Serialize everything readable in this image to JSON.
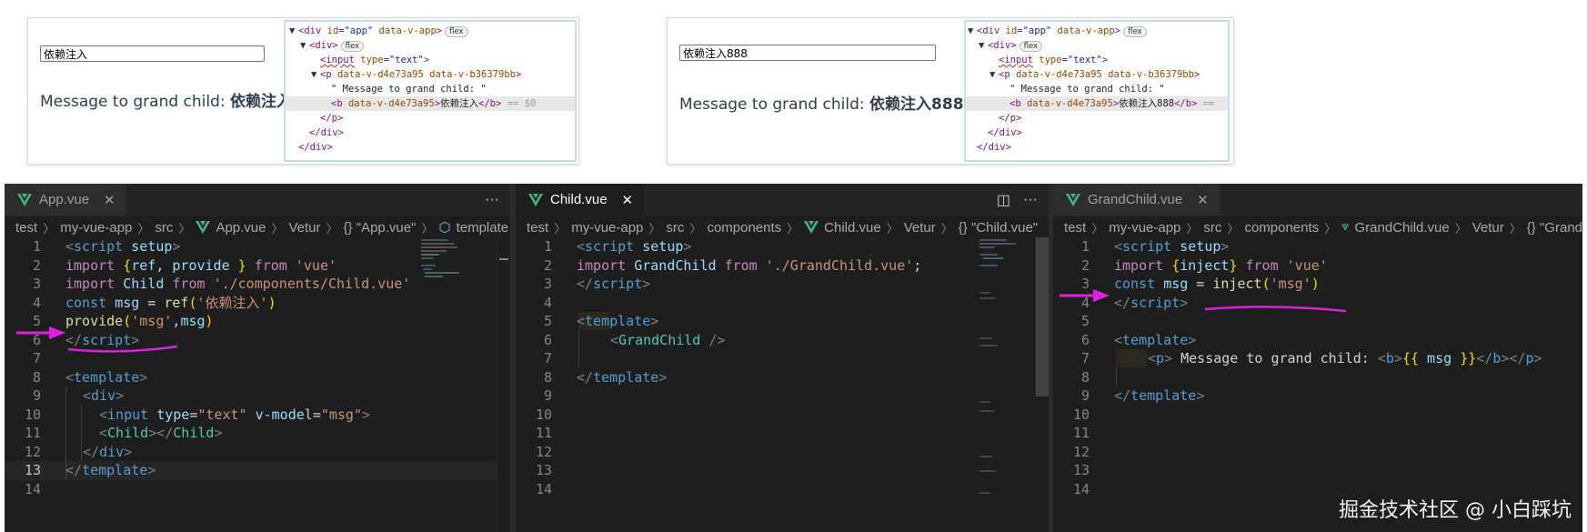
{
  "previews": [
    {
      "input_value": "依赖注入",
      "message_prefix": "Message to grand child:",
      "message_value": "依赖注入",
      "devtools": {
        "l1_tag": "<div",
        "l1_attr1": "id",
        "l1_val1": "\"app\"",
        "l1_attr2": "data-v-app",
        "l1_close": ">",
        "l1_badge": "flex",
        "l2_tag": "<div>",
        "l2_badge": "flex",
        "l3_tag": "<input",
        "l3_attr": "type",
        "l3_val": "\"text\"",
        "l3_close": ">",
        "l4_tag": "<p",
        "l4_attrs": "data-v-d4e73a95 data-v-b36379bb",
        "l4_close": ">",
        "l5_text": "\" Message to grand child: \"",
        "l6_tag": "<b",
        "l6_attr": "data-v-d4e73a95",
        "l6_text": "依赖注入",
        "l6_close": "</b>",
        "l6_tail": "== $0",
        "l7": "</p>",
        "l8": "</div>",
        "l9": "</div>"
      }
    },
    {
      "input_value": "依赖注入888",
      "message_prefix": "Message to grand child:",
      "message_value": "依赖注入888",
      "devtools": {
        "l1_tag": "<div",
        "l1_attr1": "id",
        "l1_val1": "\"app\"",
        "l1_attr2": "data-v-app",
        "l1_close": ">",
        "l1_badge": "flex",
        "l2_tag": "<div>",
        "l2_badge": "flex",
        "l3_tag": "<input",
        "l3_attr": "type",
        "l3_val": "\"text\"",
        "l3_close": ">",
        "l4_tag": "<p",
        "l4_attrs": "data-v-d4e73a95 data-v-b36379bb",
        "l4_close": ">",
        "l5_text": "\" Message to grand child: \"",
        "l6_tag": "<b",
        "l6_attr": "data-v-d4e73a95",
        "l6_text": "依赖注入888",
        "l6_close": "</b>",
        "l6_tail": "==",
        "l7": "</p>",
        "l8": "</div>",
        "l9": "</div>"
      }
    }
  ],
  "editors": [
    {
      "tab": "App.vue",
      "tab_active": false,
      "close": "✕",
      "actions": [
        "···"
      ],
      "breadcrumb": [
        "test",
        "my-vue-app",
        "src",
        "App.vue",
        "Vetur",
        "{} \"App.vue\"",
        "template"
      ],
      "line_numbers": [
        "1",
        "2",
        "3",
        "4",
        "5",
        "6",
        "7",
        "8",
        "9",
        "10",
        "11",
        "12",
        "13",
        "14"
      ],
      "current_line": "13",
      "code": {
        "l1a": "<",
        "l1b": "script",
        "l1c": "setup",
        "l1d": ">",
        "l2a": "import",
        "l2b": "{",
        "l2c": "ref",
        "l2d": ", ",
        "l2e": "provide",
        "l2f": " }",
        "l2g": "from",
        "l2h": "'vue'",
        "l3a": "import",
        "l3b": "Child",
        "l3c": "from",
        "l3d": "'./components/Child.vue'",
        "l4a": "const",
        "l4b": "msg",
        "l4c": " = ",
        "l4d": "ref",
        "l4e": "(",
        "l4f": "'依赖注入'",
        "l4g": ")",
        "l5a": "provide",
        "l5b": "(",
        "l5c": "'msg'",
        "l5d": ",",
        "l5e": "msg",
        "l5f": ")",
        "l6a": "</",
        "l6b": "script",
        "l6c": ">",
        "l8a": "<",
        "l8b": "template",
        "l8c": ">",
        "l9a": "<",
        "l9b": "div",
        "l9c": ">",
        "l10a": "<",
        "l10b": "input",
        "l10c": "type",
        "l10d": "=",
        "l10e": "\"text\"",
        "l10f": "v-model",
        "l10g": "=",
        "l10h": "\"msg\"",
        "l10i": ">",
        "l11a": "<",
        "l11b": "Child",
        "l11c": "></",
        "l11d": "Child",
        "l11e": ">",
        "l12a": "</",
        "l12b": "div",
        "l12c": ">",
        "l13a": "</",
        "l13b": "template",
        "l13c": ">"
      }
    },
    {
      "tab": "Child.vue",
      "tab_active": true,
      "close": "✕",
      "actions": [
        "◫",
        "···"
      ],
      "breadcrumb": [
        "test",
        "my-vue-app",
        "src",
        "components",
        "Child.vue",
        "Vetur",
        "{} \"Child.vue\""
      ],
      "line_numbers": [
        "1",
        "2",
        "3",
        "4",
        "5",
        "6",
        "7",
        "8",
        "9",
        "10",
        "11",
        "12",
        "13",
        "14"
      ],
      "code": {
        "l1a": "<",
        "l1b": "script",
        "l1c": "setup",
        "l1d": ">",
        "l2a": "import",
        "l2b": "GrandChild",
        "l2c": "from",
        "l2d": "'./GrandChild.vue'",
        "l2e": ";",
        "l3a": "</",
        "l3b": "script",
        "l3c": ">",
        "l5a": "<",
        "l5b": "template",
        "l5c": ">",
        "l6a": "<",
        "l6b": "GrandChild",
        "l6c": " />",
        "l8a": "</",
        "l8b": "template",
        "l8c": ">"
      }
    },
    {
      "tab": "GrandChild.vue",
      "tab_active": false,
      "close": "✕",
      "breadcrumb": [
        "test",
        "my-vue-app",
        "src",
        "components",
        "GrandChild.vue",
        "Vetur",
        "{} \"Grand"
      ],
      "line_numbers": [
        "1",
        "2",
        "3",
        "4",
        "5",
        "6",
        "7",
        "8",
        "9",
        "10",
        "11",
        "12",
        "13",
        "14"
      ],
      "code": {
        "l1a": "<",
        "l1b": "script",
        "l1c": "setup",
        "l1d": ">",
        "l2a": "import",
        "l2b": "{",
        "l2c": "inject",
        "l2d": "}",
        "l2e": "from",
        "l2f": "'vue'",
        "l3a": "const",
        "l3b": "msg",
        "l3c": " = ",
        "l3d": "inject",
        "l3e": "(",
        "l3f": "'msg'",
        "l3g": ")",
        "l4a": "</",
        "l4b": "script",
        "l4c": ">",
        "l6a": "<",
        "l6b": "template",
        "l6c": ">",
        "l7a": "<",
        "l7b": "p",
        "l7c": ">",
        "l7d": " Message to grand child: ",
        "l7e": "<",
        "l7f": "b",
        "l7g": ">",
        "l7h": "{{",
        "l7i": " msg ",
        "l7j": "}}",
        "l7k": "</",
        "l7l": "b",
        "l7m": "></",
        "l7n": "p",
        "l7o": ">",
        "l9a": "</",
        "l9b": "template",
        "l9c": ">"
      }
    }
  ],
  "watermark": "掘金技术社区 @ 小白踩坑",
  "colors": {
    "annotation": "#e020e0",
    "editor_bg": "#1e1e1e",
    "vue_green": "#41b883"
  }
}
